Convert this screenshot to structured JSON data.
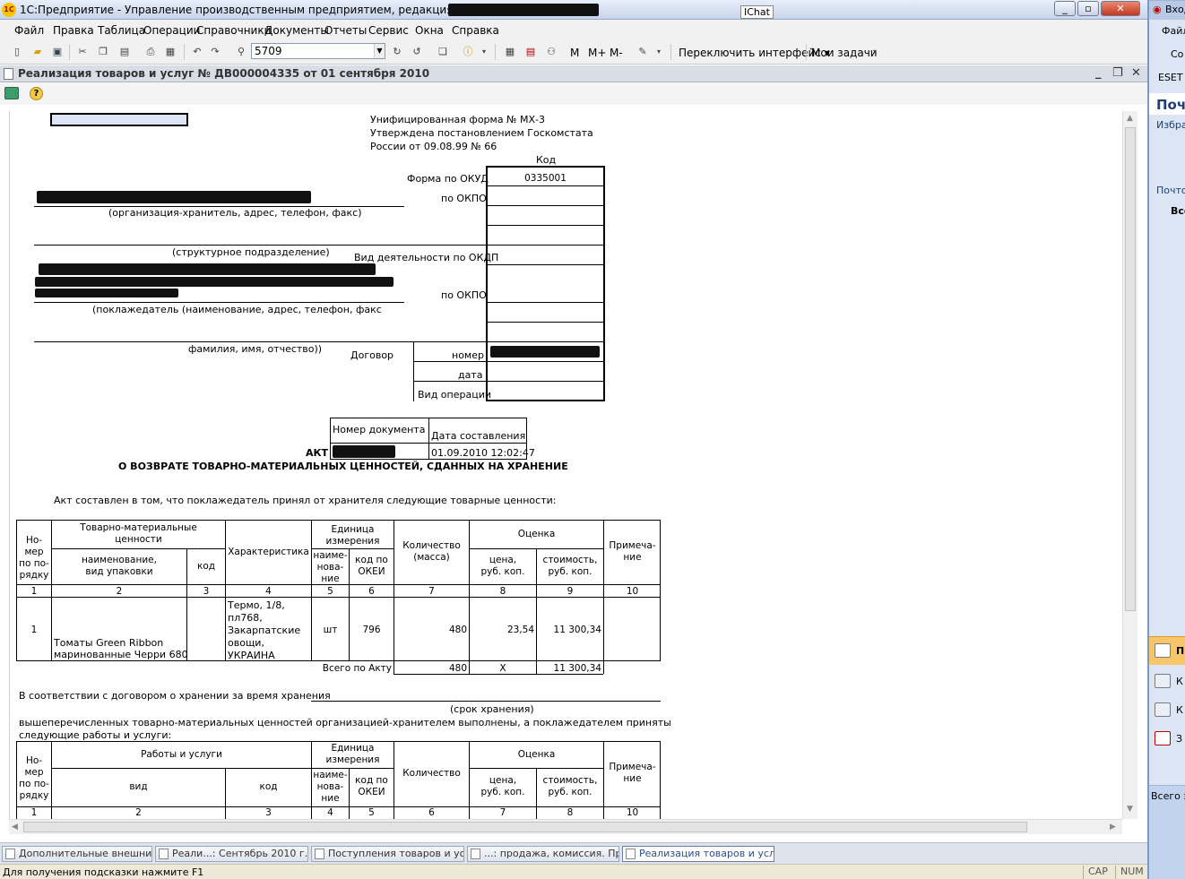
{
  "window": {
    "title": "1С:Предприятие - Управление производственным предприятием, редакция 1.3",
    "ichat_label": "IChat"
  },
  "menu": [
    "Файл",
    "Правка",
    "Таблица",
    "Операции",
    "Справочники",
    "Документы",
    "Отчеты",
    "Сервис",
    "Окна",
    "Справка"
  ],
  "toolbar": {
    "search_value": "5709",
    "m_label": "M",
    "m_plus_label": "M+",
    "m_minus_label": "M-",
    "switch_interface": "Переключить интерфейс",
    "my_tasks": "Мои задачи"
  },
  "document": {
    "title": "Реализация товаров и услуг № ДВ000004335 от 01 сентября 2010"
  },
  "form": {
    "unified_form": "Унифицированная форма № МХ-3",
    "approved_1": "Утверждена постановлением Госкомстата",
    "approved_2": "России от 09.08.99 № 66",
    "code_header": "Код",
    "okud_label": "Форма по ОКУД",
    "okud_value": "0335001",
    "okpo_label": "по ОКПО",
    "okdp_label": "Вид деятельности по ОКДП",
    "okpo2_label": "по ОКПО",
    "keeper_caption": "(организация-хранитель, адрес, телефон, факс)",
    "division_caption": "(структурное подразделение)",
    "depositor_caption": "(поклажедатель (наименование, адрес, телефон, факс",
    "fio_caption": "фамилия, имя, отчество))",
    "contract_label": "Договор",
    "number_label": "номер",
    "date_label": "дата",
    "operation_label": "Вид операции",
    "docnum_header": "Номер   документа",
    "docdate_header": "Дата  составления",
    "doc_date": "01.09.2010 12:02:47",
    "act_label": "АКТ",
    "act_title": "О ВОЗВРАТЕ ТОВАРНО-МАТЕРИАЛЬНЫХ ЦЕННОСТЕЙ, СДАННЫХ НА ХРАНЕНИЕ",
    "act_intro": "Акт составлен в том, что поклажедатель принял от хранителя следующие товарные ценности:"
  },
  "table1": {
    "h_num": "Но-\nмер\nпо по-\nрядку",
    "h_tmc": "Товарно-материальные\nценности",
    "h_name": "наименование,\nвид упаковки",
    "h_code": "код",
    "h_char": "Характеристика",
    "h_unit": "Единица\nизмерения",
    "h_unit_name": "наиме-\nнова-\nние",
    "h_unit_okei": "код по\nОКЕИ",
    "h_qty": "Количество\n(масса)",
    "h_eval": "Оценка",
    "h_price": "цена,\nруб. коп.",
    "h_cost": "стоимость,\nруб. коп.",
    "h_note": "Примеча-\nние",
    "col_numbers": [
      "1",
      "2",
      "3",
      "4",
      "5",
      "6",
      "7",
      "8",
      "9",
      "10"
    ],
    "row": {
      "num": "1",
      "name": "Томаты Green Ribbon\nмаринованные Черри 680",
      "code": "",
      "char": "Термо, 1/8,\nпл768,\nЗакарпатские\nовощи,\nУКРАИНА",
      "unit": "шт",
      "okei": "796",
      "qty": "480",
      "price": "23,54",
      "cost": "11 300,34",
      "note": ""
    },
    "total_label": "Всего по Акту",
    "total_qty": "480",
    "total_price": "X",
    "total_cost": "11 300,34"
  },
  "storage": {
    "line1": "В соответствии с договором о хранении за время хранения",
    "term_caption": "(срок хранения)",
    "line2": "вышеперечисленных товарно-материальных ценностей организацией-хранителем выполнены, а поклажедателем приняты",
    "line3": "следующие работы и услуги:"
  },
  "table2": {
    "h_num": "Но-\nмер\nпо по-\nрядку",
    "h_works": "Работы и услуги",
    "h_kind": "вид",
    "h_code": "код",
    "h_unit": "Единица\nизмерения",
    "h_unit_name": "наиме-\nнова-\nние",
    "h_unit_okei": "код по\nОКЕИ",
    "h_qty": "Количество",
    "h_eval": "Оценка",
    "h_price": "цена,\nруб. коп.",
    "h_cost": "стоимость,\nруб. коп.",
    "h_note": "Примеча-\nние",
    "col_numbers": [
      "1",
      "2",
      "3",
      "4",
      "5",
      "6",
      "7",
      "8",
      "10"
    ]
  },
  "taskbar": [
    "Дополнительные внешние ...",
    "Реали...: Сентябрь 2010 г. - ...",
    "Поступления товаров и услуг",
    "...: продажа, комиссия. Про...",
    "Реализация товаров и услу..."
  ],
  "status": {
    "hint": "Для получения подсказки нажмите F1",
    "cap": "CAP",
    "num": "NUM"
  },
  "background_window": {
    "title": "Вход",
    "menu_file": "Файл",
    "item_c": "Со",
    "eset": "ESET",
    "header": "Поч",
    "favorites": "Избра",
    "mail_folders": "Почто",
    "all": "Все",
    "nav_mail": "П",
    "nav_cal": "К",
    "nav_contacts": "К",
    "nav_tasks": "З",
    "footer": "Всего э"
  },
  "colors": {
    "titlebar": "#c7d4ea",
    "menubar": "#f1f1f1",
    "doc_titlebar": "#d8dde6",
    "taskbar": "#dfe4ec",
    "statusbar": "#ece9d8",
    "outlook_bg": "#dbe5f4",
    "close_button": "#c0391f"
  }
}
